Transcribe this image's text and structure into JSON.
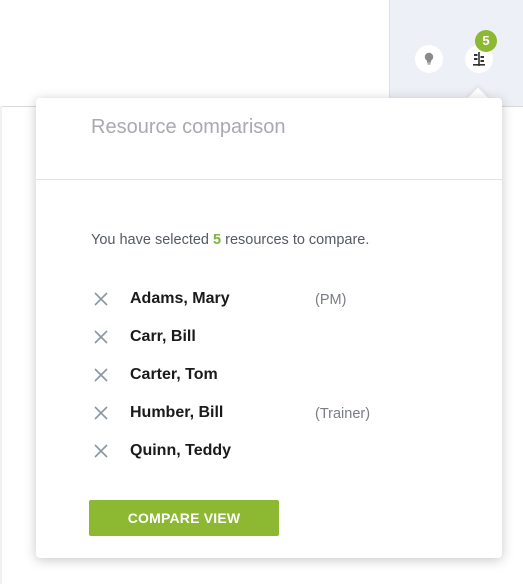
{
  "header": {
    "bulb_icon": "lightbulb-icon",
    "compare_icon": "compare-icon",
    "badge_count": "5"
  },
  "popover": {
    "title": "Resource comparison",
    "summary_prefix": "You have selected ",
    "summary_count": "5",
    "summary_suffix": " resources to compare.",
    "remove_icon": "close-icon",
    "resources": [
      {
        "name": "Adams, Mary",
        "role": "(PM)"
      },
      {
        "name": "Carr, Bill",
        "role": ""
      },
      {
        "name": "Carter, Tom",
        "role": ""
      },
      {
        "name": "Humber, Bill",
        "role": "(Trainer)"
      },
      {
        "name": "Quinn, Teddy",
        "role": ""
      }
    ],
    "button_label": "COMPARE VIEW"
  },
  "colors": {
    "accent": "#8cb832",
    "header_panel": "#eef0f7",
    "title": "#a8aab0"
  }
}
